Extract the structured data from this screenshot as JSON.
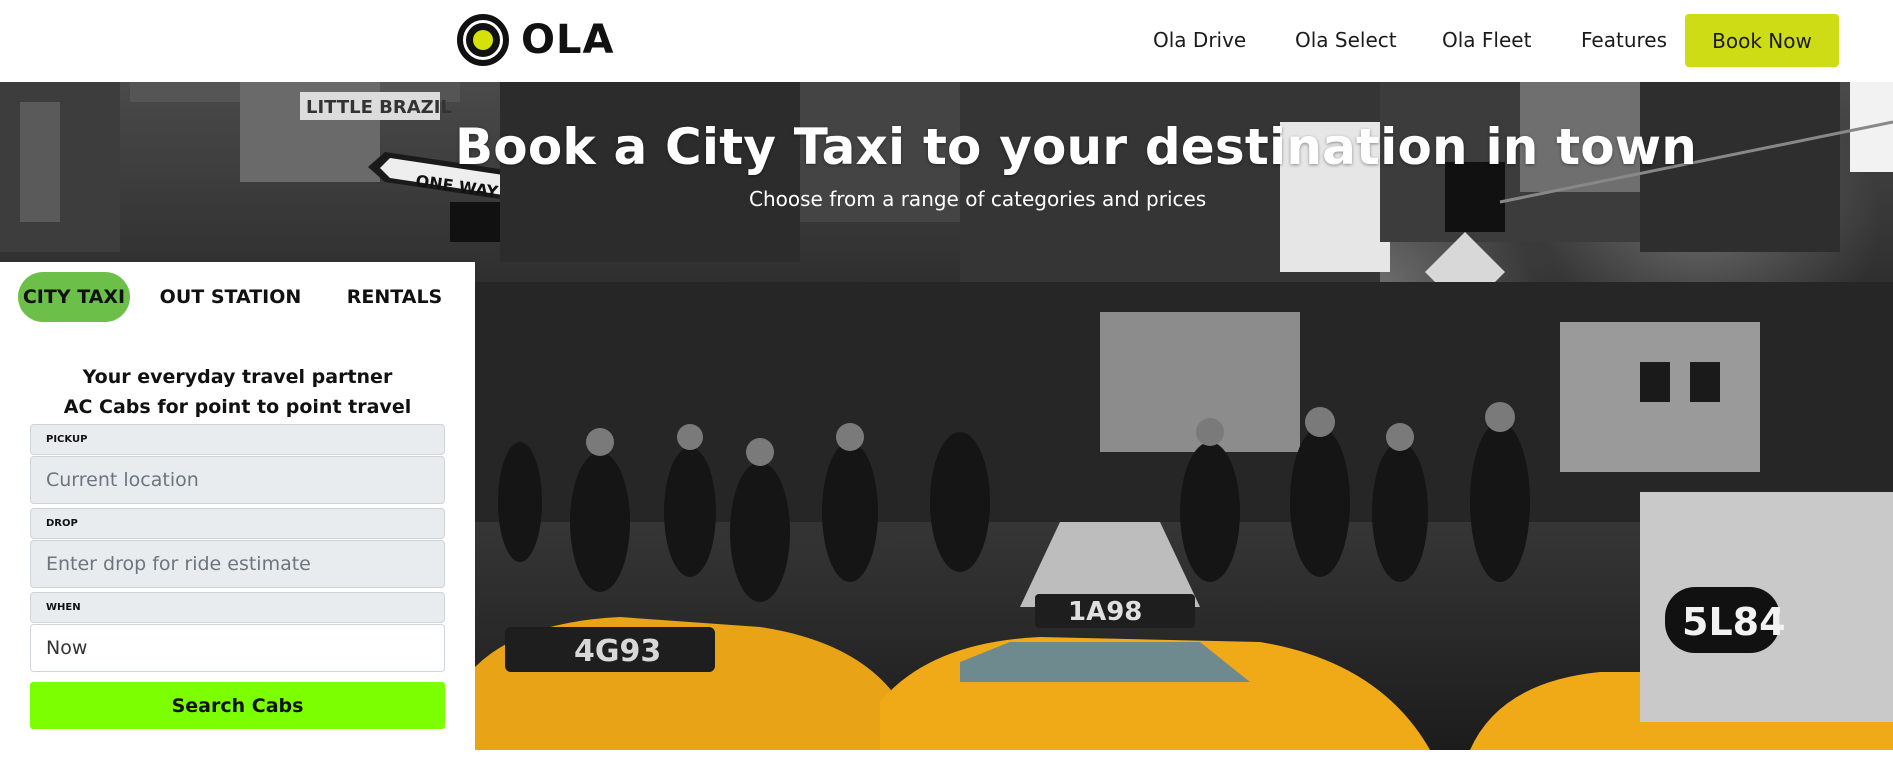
{
  "brand": {
    "name": "OLA",
    "logo_icon": "ola-logo-icon",
    "accent": "#cddc14"
  },
  "nav": {
    "links": [
      {
        "label": "Ola Drive"
      },
      {
        "label": "Ola Select"
      },
      {
        "label": "Ola Fleet"
      },
      {
        "label": "Features"
      }
    ],
    "cta_label": "Book Now"
  },
  "hero": {
    "title": "Book a City Taxi to your destination in town",
    "subtitle": "Choose from a range of categories and prices",
    "taxi_signs": [
      "4G93",
      "1A98",
      "5L84"
    ],
    "street_signs": [
      "LITTLE BRAZIL",
      "ONE WAY"
    ]
  },
  "booking": {
    "tabs": [
      {
        "label": "CITY TAXI",
        "active": true
      },
      {
        "label": "OUT STATION",
        "active": false
      },
      {
        "label": "RENTALS",
        "active": false
      }
    ],
    "tagline_line1": "Your everyday travel partner",
    "tagline_line2": "AC Cabs for point to point travel",
    "pickup": {
      "label": "PICKUP",
      "placeholder": "Current location"
    },
    "drop": {
      "label": "DROP",
      "placeholder": "Enter drop for ride estimate"
    },
    "when": {
      "label": "WHEN",
      "value": "Now"
    },
    "search_label": "Search Cabs",
    "active_tab_color": "#6cc04a",
    "search_color": "#7cff00"
  }
}
